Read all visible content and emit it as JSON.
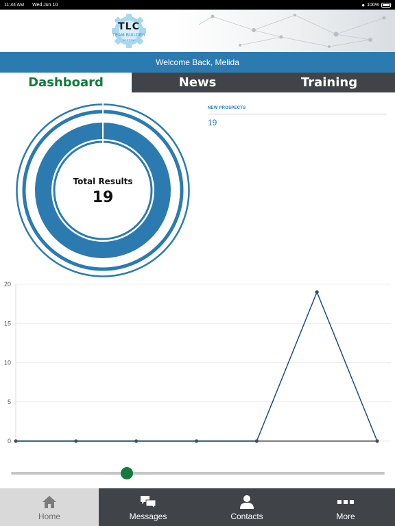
{
  "status_bar": {
    "time": "11:44 AM",
    "date": "Wed Jun 10",
    "battery": "100%"
  },
  "logo": {
    "line1": "TLC",
    "line2": "TEAM BUILDER",
    "line3": "SYSTEM"
  },
  "welcome": {
    "text": "Welcome Back, Melida"
  },
  "tabs": [
    {
      "label": "Dashboard",
      "active": true
    },
    {
      "label": "News",
      "active": false
    },
    {
      "label": "Training",
      "active": false
    }
  ],
  "summary": {
    "label": "Total Results",
    "value": "19"
  },
  "prospects": {
    "title": "NEW PROSPECTS",
    "value": "19"
  },
  "chart_data": {
    "type": "line",
    "x": [
      1,
      2,
      3,
      4,
      5,
      6,
      7
    ],
    "series": [
      {
        "values": [
          0,
          0,
          0,
          0,
          0,
          19,
          0
        ]
      }
    ],
    "ylim": [
      0,
      20
    ],
    "y_ticks": [
      "0",
      "5",
      "10",
      "15",
      "20"
    ],
    "grid": true,
    "colors": {
      "line": "#1f4e6e",
      "point": "#4a4d50",
      "grid": "#ececec",
      "axis": "#555555"
    }
  },
  "slider": {
    "value": 0.31
  },
  "colors": {
    "accent_blue": "#2b7ab0",
    "active_green": "#157a3c",
    "dark_bar": "#404448"
  },
  "bottom_nav": [
    {
      "label": "Home",
      "icon": "home-icon",
      "active": true
    },
    {
      "label": "Messages",
      "icon": "messages-icon",
      "active": false
    },
    {
      "label": "Contacts",
      "icon": "contacts-icon",
      "active": false
    },
    {
      "label": "More",
      "icon": "more-icon",
      "active": false
    }
  ]
}
